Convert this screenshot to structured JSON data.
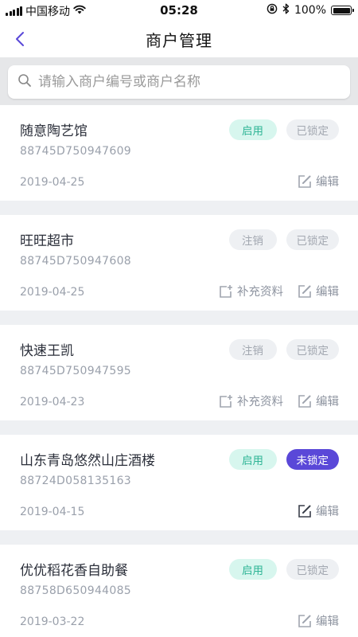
{
  "status_bar": {
    "carrier": "中国移动",
    "time": "05:28",
    "battery": "100%"
  },
  "nav": {
    "title": "商户管理"
  },
  "search": {
    "placeholder": "请输入商户编号或商户名称",
    "value": ""
  },
  "merchants": [
    {
      "name": "随意陶艺馆",
      "code": "88745D750947609",
      "date": "2019-04-25",
      "status_label": "启用",
      "lock_label": "已锁定",
      "supplement_label": "",
      "edit_label": "编辑"
    },
    {
      "name": "旺旺超市",
      "code": "88745D750947608",
      "date": "2019-04-25",
      "status_label": "注销",
      "lock_label": "已锁定",
      "supplement_label": "补充资料",
      "edit_label": "编辑"
    },
    {
      "name": "快速王凯",
      "code": "88745D750947595",
      "date": "2019-04-23",
      "status_label": "注销",
      "lock_label": "已锁定",
      "supplement_label": "补充资料",
      "edit_label": "编辑"
    },
    {
      "name": "山东青岛悠然山庄酒楼",
      "code": "88724D058135163",
      "date": "2019-04-15",
      "status_label": "启用",
      "lock_label": "未锁定",
      "supplement_label": "",
      "edit_label": "编辑"
    },
    {
      "name": "优优稻花香自助餐",
      "code": "88758D650944085",
      "date": "2019-03-22",
      "status_label": "启用",
      "lock_label": "已锁定",
      "supplement_label": "",
      "edit_label": "编辑"
    }
  ],
  "colors": {
    "accent": "#5a48d8",
    "enabled_bg": "#d7f6ee",
    "enabled_text": "#2fb596",
    "muted_bg": "#eef0f3",
    "muted_text": "#a3a8b1"
  }
}
